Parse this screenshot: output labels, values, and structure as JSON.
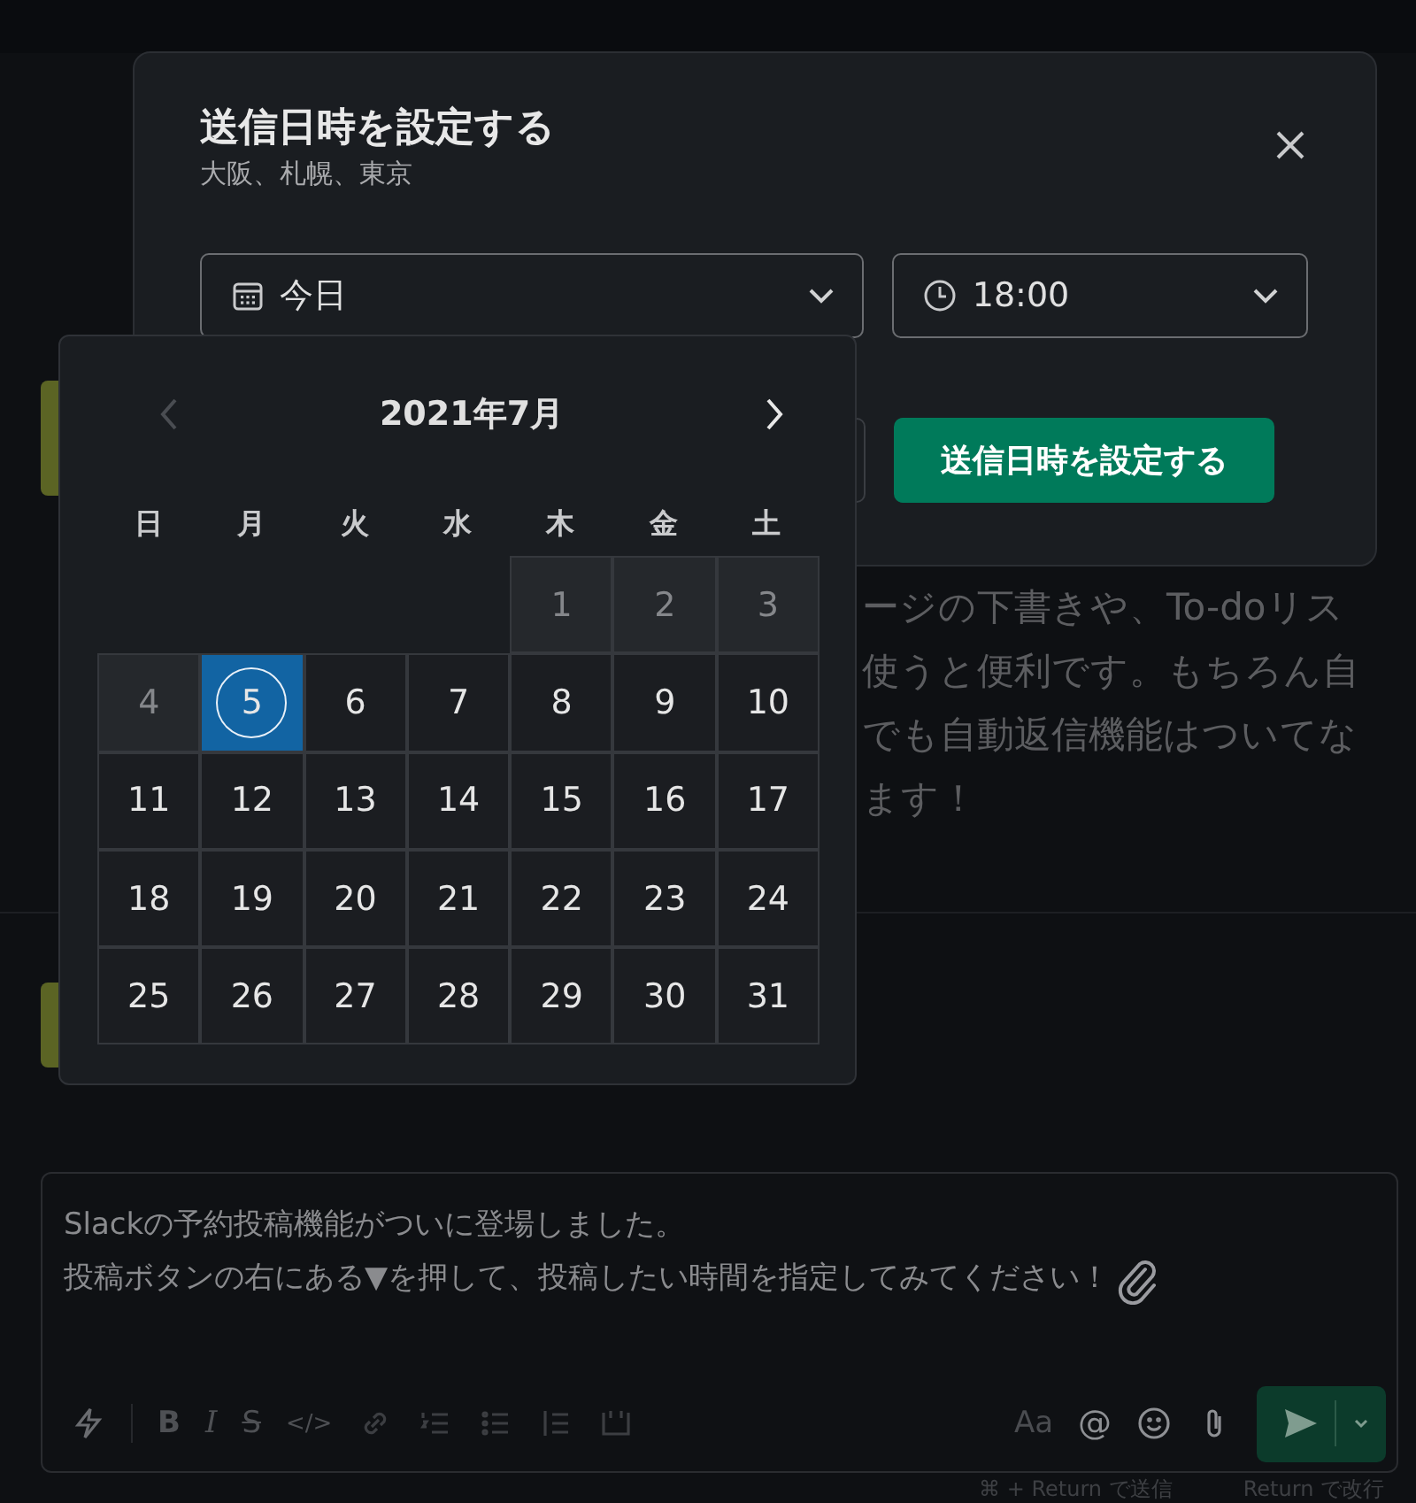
{
  "background": {
    "message_lines": [
      "ージの下書きや、To-doリス",
      "使うと便利です。もちろん自",
      "でも自動返信機能はついてな",
      "ます！"
    ]
  },
  "dialog": {
    "title": "送信日時を設定する",
    "subtitle": "大阪、札幌、東京",
    "date_select": {
      "value": "今日"
    },
    "time_select": {
      "value": "18:00"
    },
    "submit": "送信日時を設定する"
  },
  "calendar": {
    "month": "2021年7月",
    "prev_disabled": true,
    "weekdays": [
      "日",
      "月",
      "火",
      "水",
      "木",
      "金",
      "土"
    ],
    "weeks": [
      [
        {
          "day": "1",
          "disabled": true,
          "selected": false,
          "today": false
        },
        {
          "day": "2",
          "disabled": true,
          "selected": false,
          "today": false
        },
        {
          "day": "3",
          "disabled": true,
          "selected": false,
          "today": false
        }
      ],
      [
        {
          "day": "4",
          "disabled": true,
          "selected": false,
          "today": false
        },
        {
          "day": "5",
          "disabled": false,
          "selected": true,
          "today": true
        },
        {
          "day": "6",
          "disabled": false,
          "selected": false,
          "today": false
        },
        {
          "day": "7",
          "disabled": false,
          "selected": false,
          "today": false
        },
        {
          "day": "8",
          "disabled": false,
          "selected": false,
          "today": false
        },
        {
          "day": "9",
          "disabled": false,
          "selected": false,
          "today": false
        },
        {
          "day": "10",
          "disabled": false,
          "selected": false,
          "today": false
        }
      ],
      [
        {
          "day": "11",
          "disabled": false,
          "selected": false,
          "today": false
        },
        {
          "day": "12",
          "disabled": false,
          "selected": false,
          "today": false
        },
        {
          "day": "13",
          "disabled": false,
          "selected": false,
          "today": false
        },
        {
          "day": "14",
          "disabled": false,
          "selected": false,
          "today": false
        },
        {
          "day": "15",
          "disabled": false,
          "selected": false,
          "today": false
        },
        {
          "day": "16",
          "disabled": false,
          "selected": false,
          "today": false
        },
        {
          "day": "17",
          "disabled": false,
          "selected": false,
          "today": false
        }
      ],
      [
        {
          "day": "18",
          "disabled": false,
          "selected": false,
          "today": false
        },
        {
          "day": "19",
          "disabled": false,
          "selected": false,
          "today": false
        },
        {
          "day": "20",
          "disabled": false,
          "selected": false,
          "today": false
        },
        {
          "day": "21",
          "disabled": false,
          "selected": false,
          "today": false
        },
        {
          "day": "22",
          "disabled": false,
          "selected": false,
          "today": false
        },
        {
          "day": "23",
          "disabled": false,
          "selected": false,
          "today": false
        },
        {
          "day": "24",
          "disabled": false,
          "selected": false,
          "today": false
        }
      ],
      [
        {
          "day": "25",
          "disabled": false,
          "selected": false,
          "today": false
        },
        {
          "day": "26",
          "disabled": false,
          "selected": false,
          "today": false
        },
        {
          "day": "27",
          "disabled": false,
          "selected": false,
          "today": false
        },
        {
          "day": "28",
          "disabled": false,
          "selected": false,
          "today": false
        },
        {
          "day": "29",
          "disabled": false,
          "selected": false,
          "today": false
        },
        {
          "day": "30",
          "disabled": false,
          "selected": false,
          "today": false
        },
        {
          "day": "31",
          "disabled": false,
          "selected": false,
          "today": false
        }
      ]
    ]
  },
  "composer": {
    "lines": [
      "Slackの予約投稿機能がついに登場しました。",
      "投稿ボタンの右にある▼を押して、投稿したい時間を指定してみてください！"
    ],
    "toolbar": {
      "bold": "B",
      "italic": "I",
      "strike": "S",
      "code": "</>",
      "format": "Aa",
      "mention": "@"
    },
    "hints": [
      "⌘ + Return で送信",
      "Return で改行"
    ]
  }
}
